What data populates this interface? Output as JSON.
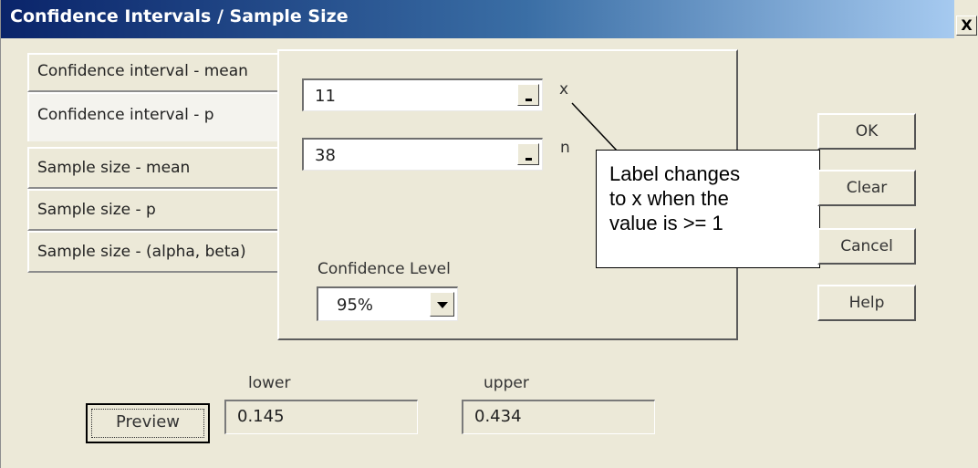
{
  "window": {
    "title": "Confidence Intervals / Sample Size",
    "close_glyph": "X"
  },
  "tabs": [
    {
      "label": "Confidence interval - mean",
      "selected": false
    },
    {
      "label": "Confidence interval - p",
      "selected": true
    },
    {
      "label": "Sample size - mean",
      "selected": false
    },
    {
      "label": "Sample size - p",
      "selected": false
    },
    {
      "label": "Sample size - (alpha, beta)",
      "selected": false
    }
  ],
  "inputs": {
    "x": {
      "value": "11",
      "label": "x"
    },
    "n": {
      "value": "38",
      "label": "n"
    }
  },
  "confidence": {
    "label": "Confidence Level",
    "selected": "95%"
  },
  "callout": {
    "lines": [
      "Label changes",
      "to x when the",
      "value is >= 1"
    ]
  },
  "buttons": {
    "ok": "OK",
    "clear": "Clear",
    "cancel": "Cancel",
    "help": "Help",
    "preview": "Preview"
  },
  "results": {
    "lower_label": "lower",
    "lower_value": "0.145",
    "upper_label": "upper",
    "upper_value": "0.434"
  }
}
